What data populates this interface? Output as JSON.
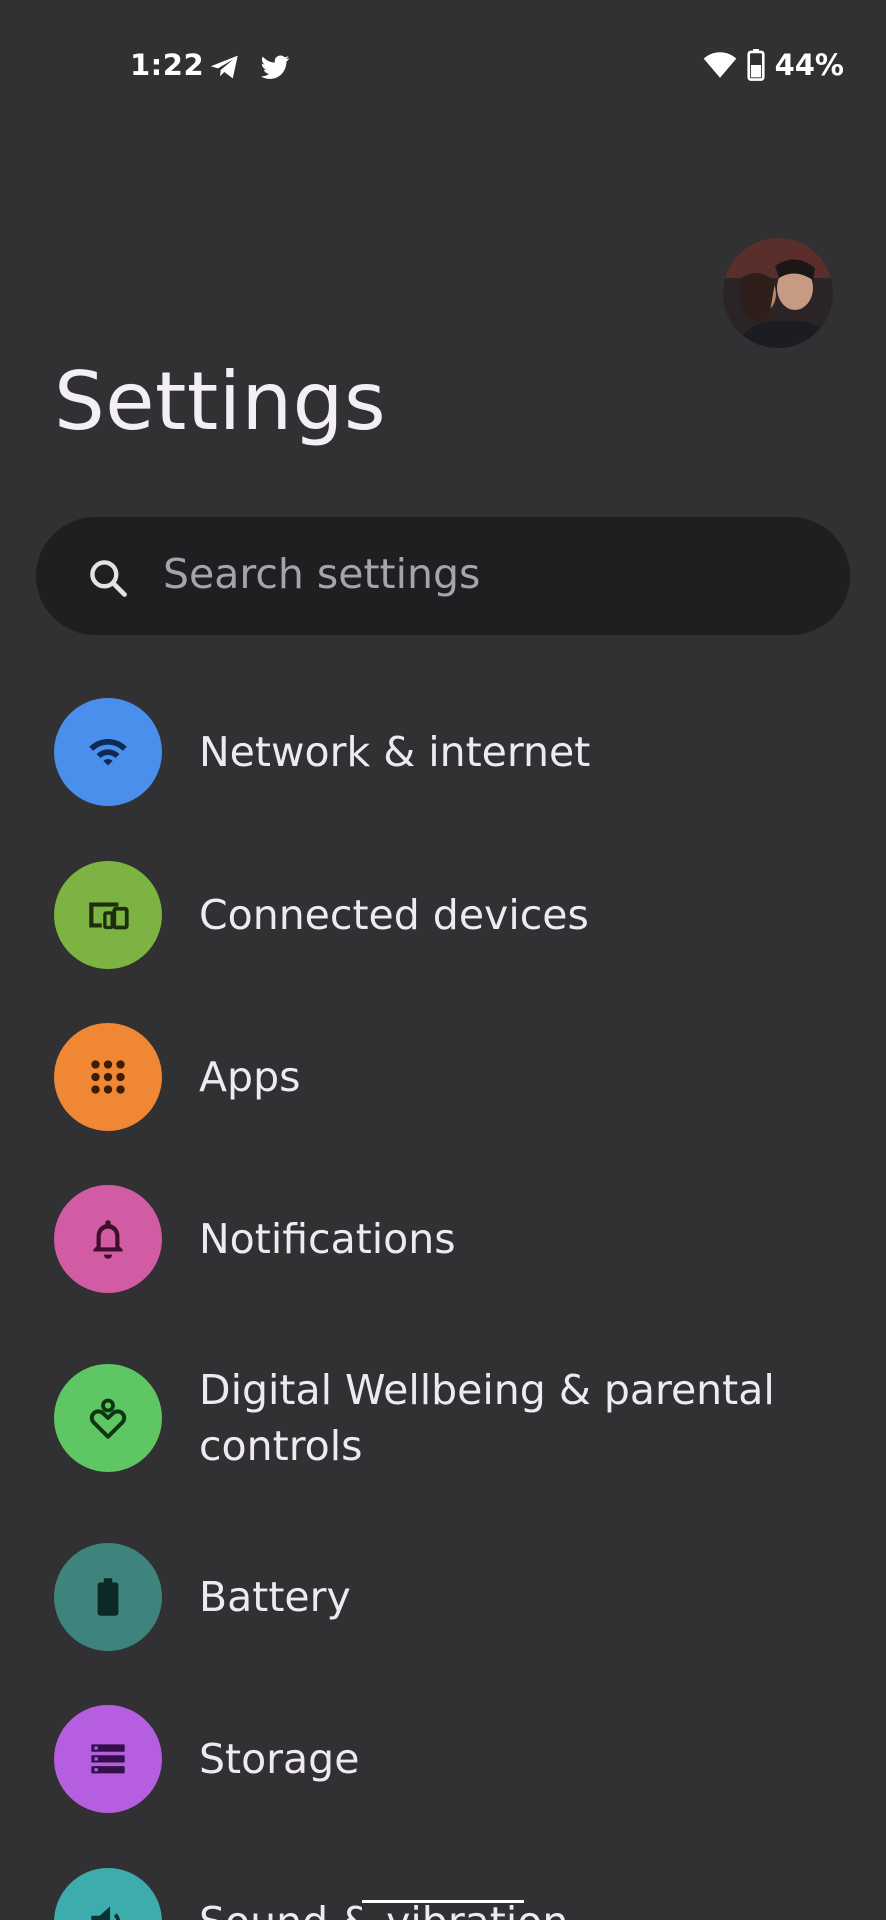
{
  "status_bar": {
    "time": "1:22",
    "notification_icons": [
      "telegram-icon",
      "twitter-icon"
    ],
    "wifi_icon": "wifi-icon",
    "battery_icon": "battery-icon",
    "battery_percent": "44%"
  },
  "header": {
    "title": "Settings"
  },
  "search": {
    "placeholder": "Search settings"
  },
  "items": [
    {
      "label": "Network & internet",
      "icon": "wifi-icon",
      "color": "#4a8fec"
    },
    {
      "label": "Connected devices",
      "icon": "devices-icon",
      "color": "#7cb342"
    },
    {
      "label": "Apps",
      "icon": "apps-grid-icon",
      "color": "#ef8734"
    },
    {
      "label": "Notifications",
      "icon": "bell-icon",
      "color": "#d15ca4"
    },
    {
      "label": "Digital Wellbeing & parental controls",
      "icon": "wellbeing-icon",
      "color": "#5ec764"
    },
    {
      "label": "Battery",
      "icon": "battery-icon",
      "color": "#3f847c"
    },
    {
      "label": "Storage",
      "icon": "storage-icon",
      "color": "#b65ee0"
    },
    {
      "label": "Sound & vibration",
      "icon": "sound-icon",
      "color": "#3cacac"
    }
  ]
}
